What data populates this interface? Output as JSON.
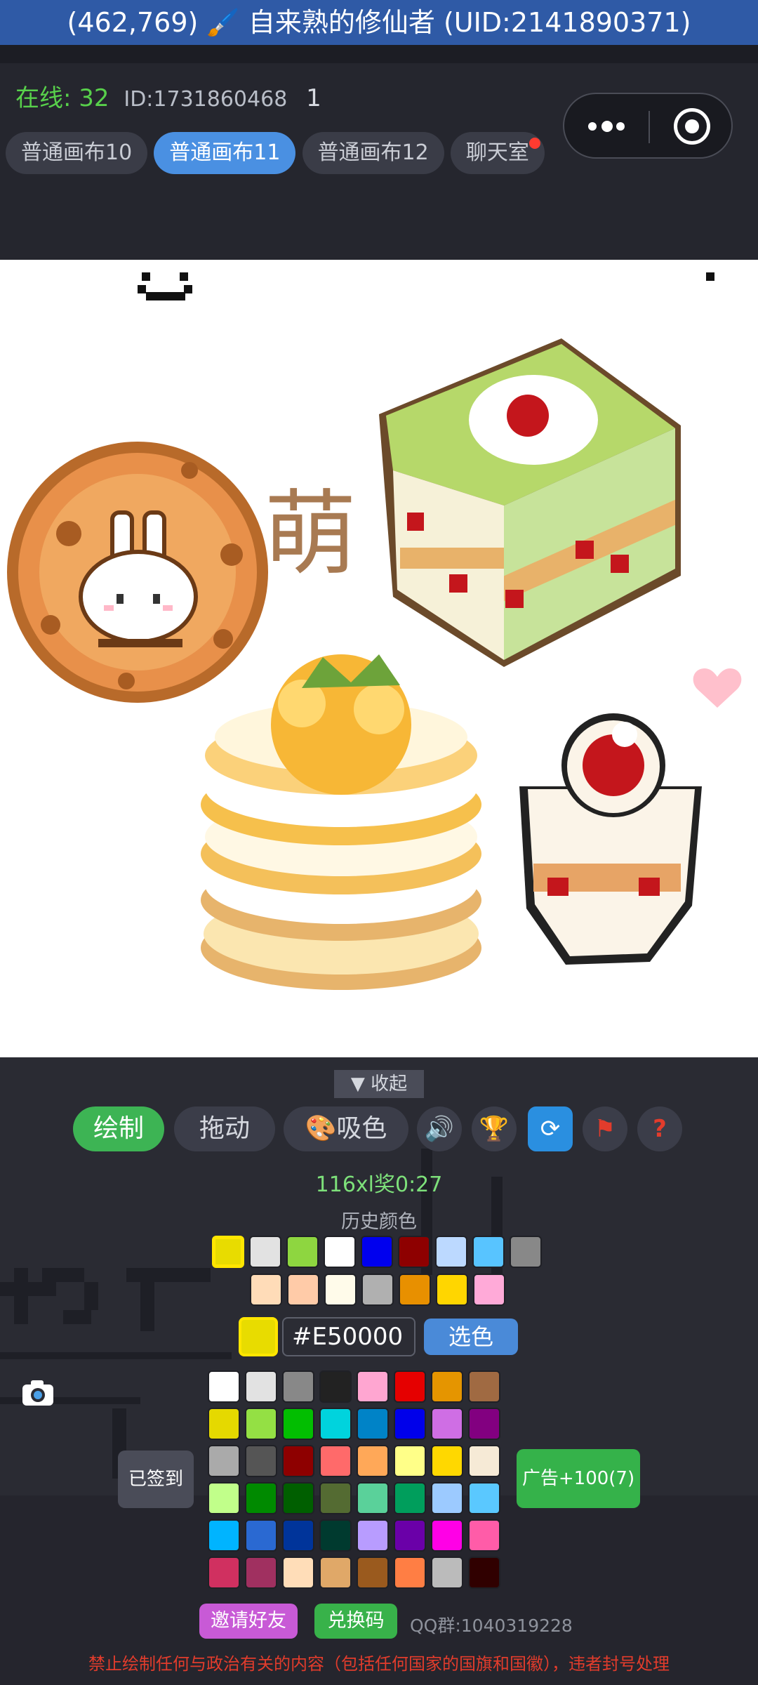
{
  "title": {
    "coords": "(462,769)",
    "emoji": "🖌️",
    "user": "自来熟的修仙者",
    "uid": "(UID:2141890371)"
  },
  "status": {
    "online_label": "在线:",
    "online_count": "32",
    "id": "ID:1731860468",
    "num": "1"
  },
  "tabs": [
    {
      "label": "普通画布10",
      "active": false
    },
    {
      "label": "普通画布11",
      "active": true
    },
    {
      "label": "普通画布12",
      "active": false
    },
    {
      "label": "聊天室",
      "active": false,
      "badge": true
    }
  ],
  "canvas": {
    "art_text": "萌"
  },
  "panel": {
    "collapse": "▼ 收起",
    "tools": {
      "draw": "绘制",
      "drag": "拖动",
      "pick": "🎨吸色"
    },
    "icons": [
      "speaker-icon",
      "trophy-icon",
      "refresh-icon",
      "flag-icon",
      "help-icon"
    ],
    "cooldown": "116xl奖0:27",
    "history_title": "历史颜色",
    "history_row1": [
      "#e8dc00",
      "#e2e2e2",
      "#8ed640",
      "#ffffff",
      "#0000ee",
      "#8e0000",
      "#bcd9ff",
      "#58c4ff",
      "#888888"
    ],
    "history_row2": [
      "#ffdcb8",
      "#ffcba8",
      "#fffbea",
      "#b0b0b0",
      "#e89000",
      "#ffd600",
      "#ffaad8"
    ],
    "current_color": "#e8dc00",
    "hex_value": "#E50000",
    "choose_label": "选色",
    "palette": [
      [
        "#ffffff",
        "#e2e2e2",
        "#888888",
        "#222222",
        "#ffa6d1",
        "#e50000",
        "#e59500",
        "#a06a42"
      ],
      [
        "#e5d900",
        "#94e044",
        "#02be01",
        "#00d3dd",
        "#0083c7",
        "#0000ea",
        "#cf6ee4",
        "#820080"
      ],
      [
        "#aaaaaa",
        "#555555",
        "#8e0000",
        "#ff6a6a",
        "#ffa858",
        "#ffff88",
        "#ffd800",
        "#f6ead6"
      ],
      [
        "#c1ff8a",
        "#008a00",
        "#005f00",
        "#546b32",
        "#5ad19a",
        "#009e5c",
        "#9ccaff",
        "#5ac8ff"
      ],
      [
        "#00b4ff",
        "#2a69d2",
        "#00349a",
        "#003a2f",
        "#b89cff",
        "#6a00a8",
        "#ff00e6",
        "#ff5ca8"
      ],
      [
        "#d03060",
        "#a03060",
        "#ffddb8",
        "#e0a868",
        "#9a5a1e",
        "#ff7e44",
        "#bbbbbb",
        "#300000"
      ]
    ],
    "signed": "已签到",
    "ad": "广告+100(7)",
    "invite": "邀请好友",
    "redeem": "兑换码",
    "qq": "QQ群:1040319228",
    "warning": "禁止绘制任何与政治有关的内容（包括任何国家的国旗和国徽），违者封号处理"
  }
}
